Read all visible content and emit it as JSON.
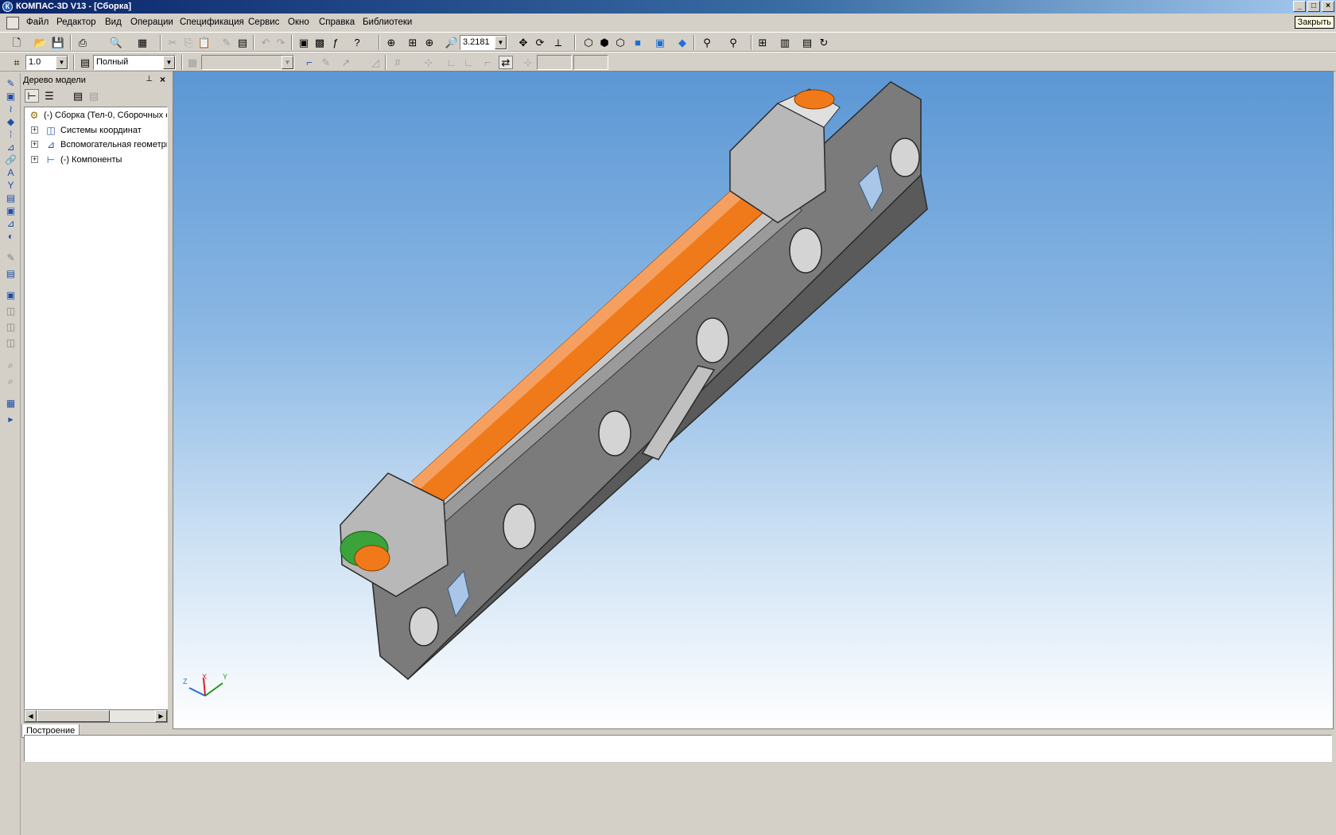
{
  "window": {
    "title": "КОМПАС-3D V13 - [Сборка]",
    "close_tooltip": "Закрыть"
  },
  "menu": [
    "Файл",
    "Редактор",
    "Вид",
    "Операции",
    "Спецификация",
    "Сервис",
    "Окно",
    "Справка",
    "Библиотеки"
  ],
  "toolbar": {
    "zoom_value": "3.2181",
    "step_value": "1.0",
    "view_mode": "Полный",
    "layer_value": ""
  },
  "tree_panel": {
    "title": "Дерево модели",
    "root": "(-) Сборка (Тел-0, Сборочных е",
    "items": [
      "Системы координат",
      "Вспомогательная геометри",
      "(-) Компоненты"
    ],
    "tab": "Построение"
  },
  "axes": {
    "x": "X",
    "y": "Y",
    "z": "Z"
  },
  "status": {
    "text": ""
  },
  "colors": {
    "titlebar": "#0a246a",
    "viewport_top": "#5b97d4",
    "part_gray": "#7a7a7a",
    "rod_orange": "#f07a1a",
    "green_accent": "#3aa33a"
  }
}
